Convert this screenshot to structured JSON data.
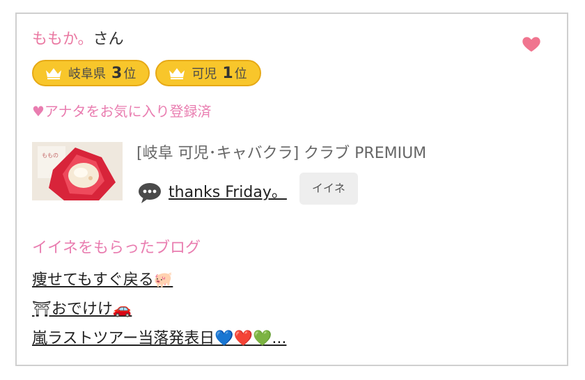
{
  "profile": {
    "nickname": "ももか。",
    "suffix": "さん",
    "favorite_icon": "heart-icon",
    "favorite_color": "#f0758f"
  },
  "rankings": [
    {
      "area": "岐阜県",
      "rank": "3",
      "unit": "位",
      "icon": "crown-icon"
    },
    {
      "area": "可児",
      "rank": "1",
      "unit": "位",
      "icon": "crown-icon"
    }
  ],
  "favorite_status": "♥アナタをお気に入り登録済",
  "latest_post": {
    "shop": "[岐阜 可児･キャバクラ]  クラブ PREMIUM",
    "title": "thanks Friday。",
    "comment_icon": "speech-bubble-icon",
    "like_label": "イイネ"
  },
  "liked_blogs": {
    "heading": "イイネをもらったブログ",
    "items": [
      "痩せてもすぐ戻る🐖",
      "⛩おでけけ🚗",
      "嵐ラストツアー当落発表日💙❤️💚..."
    ]
  },
  "colors": {
    "accent_pink": "#e97db0",
    "badge_yellow": "#f8c62b"
  }
}
